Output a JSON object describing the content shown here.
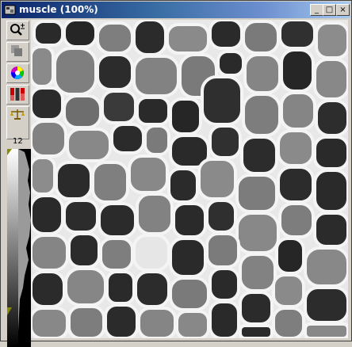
{
  "window": {
    "title": "muscle (100%)"
  },
  "title_buttons": {
    "minimize": "_",
    "maximize": "□",
    "close": "×"
  },
  "toolbar": {
    "tools": [
      {
        "icon": "zoom-icon"
      },
      {
        "icon": "layers-icon"
      },
      {
        "icon": "color-wheel-icon"
      },
      {
        "icon": "rgb-channels-icon"
      },
      {
        "icon": "calibration-scale-icon"
      }
    ],
    "calibration_value": "12"
  },
  "image": {
    "name": "muscle"
  },
  "colors": {
    "title_start": "#0a246a",
    "title_end": "#a6caf0",
    "face": "#d4d0c8"
  }
}
